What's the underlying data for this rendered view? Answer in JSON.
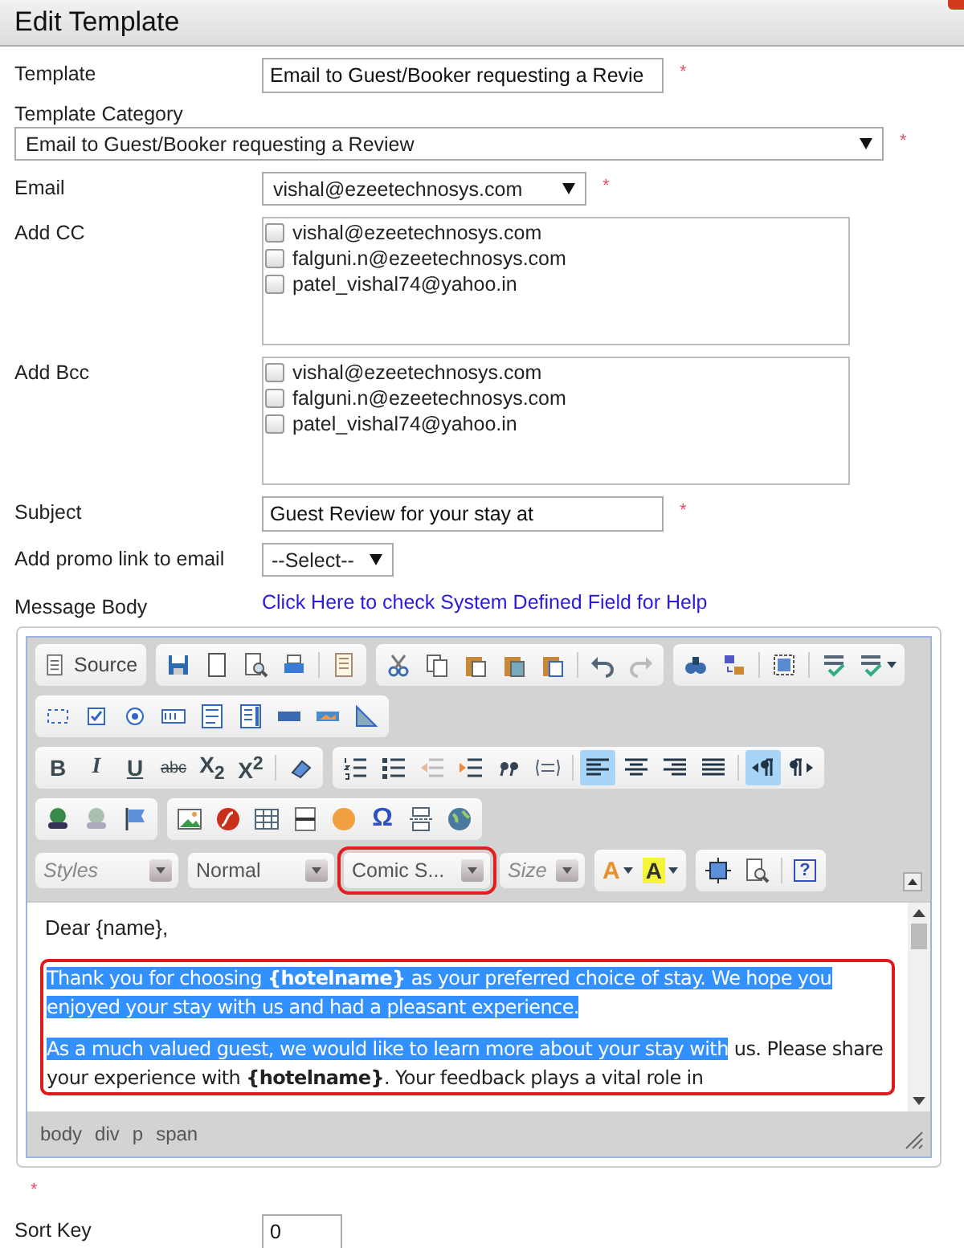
{
  "dialog": {
    "title": "Edit Template"
  },
  "template": {
    "label": "Template",
    "value": "Email to Guest/Booker requesting a Revie",
    "mark": "*"
  },
  "category": {
    "label": "Template Category",
    "value": "Email to Guest/Booker requesting a Review",
    "mark": "*"
  },
  "email": {
    "label": "Email",
    "value": "vishal@ezeetechnosys.com",
    "mark": "*"
  },
  "add_cc": {
    "label": "Add CC",
    "options": [
      {
        "label": "vishal@ezeetechnosys.com",
        "checked": false
      },
      {
        "label": "falguni.n@ezeetechnosys.com",
        "checked": false
      },
      {
        "label": "patel_vishal74@yahoo.in",
        "checked": false
      }
    ]
  },
  "add_bcc": {
    "label": "Add Bcc",
    "options": [
      {
        "label": "vishal@ezeetechnosys.com",
        "checked": false
      },
      {
        "label": "falguni.n@ezeetechnosys.com",
        "checked": false
      },
      {
        "label": "patel_vishal74@yahoo.in",
        "checked": false
      }
    ]
  },
  "subject": {
    "label": "Subject",
    "value": "Guest Review for your stay at",
    "mark": "*"
  },
  "promo": {
    "label": "Add promo link to email",
    "value": "--Select--"
  },
  "message_body": {
    "label": "Message Body",
    "help_link": "Click Here to check System Defined Field for Help"
  },
  "toolbar": {
    "source": "Source",
    "bold": "B",
    "italic": "I",
    "underline": "U",
    "strike": "abc",
    "subscript": "X$_{2}$",
    "superscript": "X$^{2}$",
    "special_char": "Ω",
    "text_color": "A",
    "bg_color": "A",
    "help": "?",
    "align": [
      {
        "selected": true
      },
      {
        "selected": false
      },
      {
        "selected": false
      },
      {
        "selected": false
      }
    ],
    "direction": [
      {
        "selected": true
      },
      {
        "selected": false
      }
    ],
    "styles": {
      "placeholder": "Styles"
    },
    "format": {
      "value": "Normal"
    },
    "font": {
      "value": "Comic S...",
      "highlighted": true
    },
    "size": {
      "placeholder": "Size"
    }
  },
  "editor": {
    "greeting": "Dear {name},",
    "highlighted": true,
    "paragraphs": [
      {
        "segments": [
          {
            "text": "Thank you for choosing **{hotelname}** as your preferred choice of stay. We hope you enjoyed your stay with us and had a pleasant experience.",
            "selected": true
          }
        ]
      },
      {
        "segments": [
          {
            "text": "As a much valued guest, we would like to learn more about your stay with",
            "selected": true
          },
          {
            "text": " us. Please share your experience with **{hotelname}**. Your feedback plays a vital role in",
            "selected": false
          }
        ]
      }
    ],
    "path": [
      "body",
      "div",
      "p",
      "span"
    ]
  },
  "body_mark": "*",
  "sort_key": {
    "label": "Sort Key",
    "value": "0"
  }
}
